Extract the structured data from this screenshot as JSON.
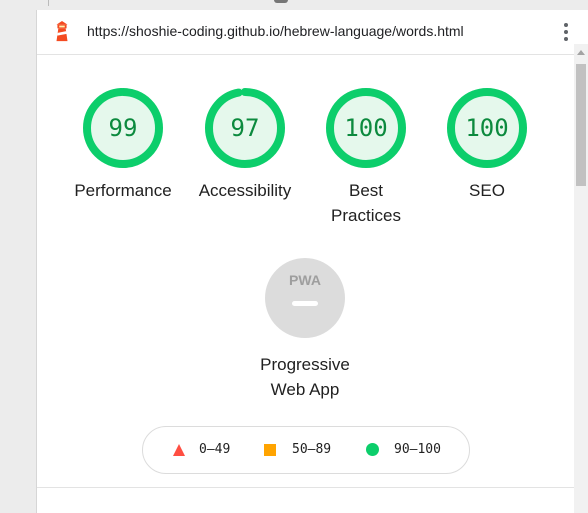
{
  "url": "https://shoshie-coding.github.io/hebrew-language/words.html",
  "colors": {
    "pass": "#0cce6b",
    "pass_text": "#0c8a3e",
    "pass_fill": "#e5f8ec",
    "average": "#ffa400",
    "fail": "#ff4e42",
    "na": "#dcdcdc"
  },
  "gauges": [
    {
      "value": "99",
      "score": 0.99,
      "label": "Performance"
    },
    {
      "value": "97",
      "score": 0.97,
      "label": "Accessibility"
    },
    {
      "value": "100",
      "score": 1.0,
      "label": "Best Practices"
    },
    {
      "value": "100",
      "score": 1.0,
      "label": "SEO"
    }
  ],
  "pwa": {
    "badge": "PWA",
    "label": "Progressive Web App"
  },
  "legend": {
    "fail": "0–49",
    "average": "50–89",
    "pass": "90–100"
  },
  "icons": {
    "logo": "lighthouse-icon",
    "menu": "more-vertical-icon"
  }
}
